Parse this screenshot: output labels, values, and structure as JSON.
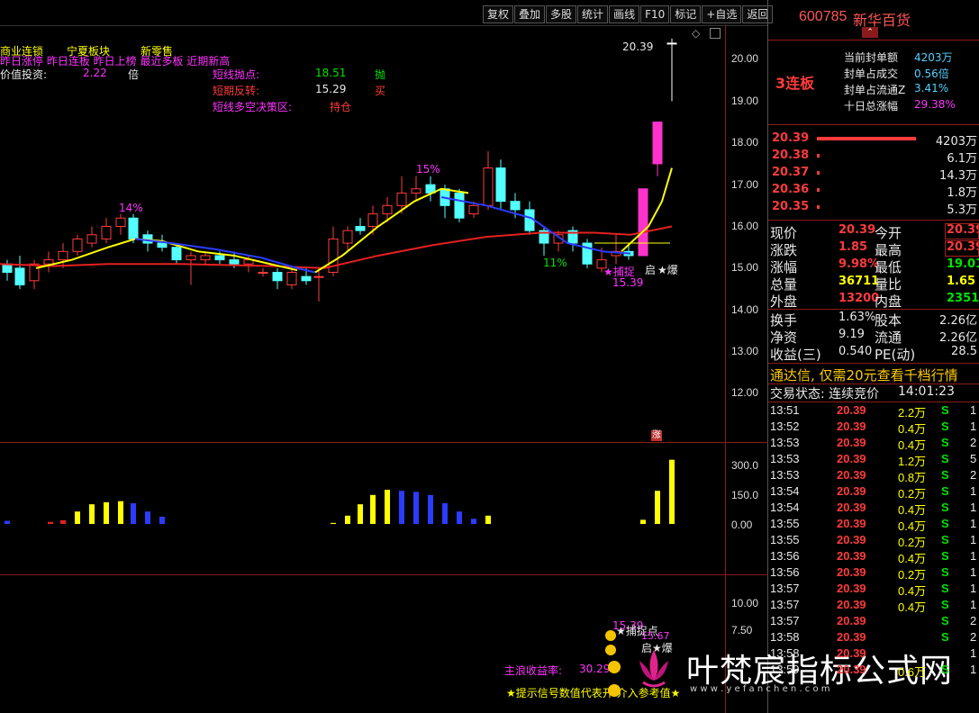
{
  "toolbar": {
    "buttons": [
      "复权",
      "叠加",
      "多股",
      "统计",
      "画线",
      "F10",
      "标记",
      "+自选",
      "返回"
    ]
  },
  "main_chart": {
    "indicator_line1": [
      "商业连锁",
      "宁夏板块",
      "新零售"
    ],
    "indicator_line2": "昨日涨停 昨日连板 昨日上榜 最近多板 近期新高",
    "value_label": "价值投资:",
    "value_num": "2.22",
    "value_unit": "倍",
    "signal_rows": [
      {
        "label": "短线抛点:",
        "value": "18.51",
        "action": "抛"
      },
      {
        "label": "短期反转:",
        "value": "15.29",
        "action": "买"
      },
      {
        "label": "短线多空决策区:",
        "value": "",
        "action": "持仓"
      }
    ],
    "peak_label": "20.39",
    "annotations": {
      "p1": "14%",
      "p2": "15%",
      "p3": "11%",
      "capture": "★捕捉",
      "capture_price": "15.39",
      "qi": "启",
      "bao": "★爆"
    },
    "y_ticks": [
      "20.00",
      "19.00",
      "18.00",
      "17.00",
      "16.00",
      "15.00",
      "14.00",
      "13.00",
      "12.00"
    ]
  },
  "volume_chart": {
    "y_ticks": [
      "300.0",
      "150.0",
      "0.00"
    ],
    "zhang_tag": "涨"
  },
  "lower_chart": {
    "y_ticks": [
      "10.00",
      "7.50"
    ],
    "price_top": "15.39",
    "capture_point": "★捕捉点",
    "partial_value": "15.67",
    "qi_bao": "启★爆",
    "income_label": "主浪收益率:",
    "income_value": "30.29",
    "footer_hint": "★提示信号数值代表开   介入参考值★"
  },
  "watermark": {
    "title": "叶梵宸指标公式网",
    "url": "w w w . y e f a n c h e n . c o m"
  },
  "stock": {
    "code": "600785",
    "name": "新华百货",
    "board_tag": "3连板",
    "seal": [
      {
        "label": "当前封单额",
        "value": "4203万"
      },
      {
        "label": "封单占成交",
        "value": "0.56倍"
      },
      {
        "label": "封单占流通Z",
        "value": "3.41%"
      },
      {
        "label": "十日总涨幅",
        "value": "29.38%"
      }
    ],
    "bids": [
      {
        "price": "20.39",
        "vol": "4203万",
        "bar": 1.0
      },
      {
        "price": "20.38",
        "vol": "6.1万",
        "bar": 0.02
      },
      {
        "price": "20.37",
        "vol": "14.3万",
        "bar": 0.03
      },
      {
        "price": "20.36",
        "vol": "1.8万",
        "bar": 0.01
      },
      {
        "price": "20.35",
        "vol": "5.3万",
        "bar": 0.02
      }
    ],
    "quote": [
      [
        "现价",
        "20.39",
        "今开",
        "20.39"
      ],
      [
        "涨跌",
        "1.85",
        "最高",
        "20.39"
      ],
      [
        "涨幅",
        "9.98%",
        "最低",
        "19.01"
      ],
      [
        "总量",
        "36711",
        "量比",
        "1.65"
      ],
      [
        "外盘",
        "13200",
        "内盘",
        "23511"
      ]
    ],
    "stats": [
      [
        "换手",
        "1.63%",
        "股本",
        "2.26亿"
      ],
      [
        "净资",
        "9.19",
        "流通",
        "2.26亿"
      ],
      [
        "收益(三)",
        "0.540",
        "PE(动)",
        "28.5"
      ]
    ],
    "promo": "通达信, 仅需20元查看千档行情",
    "trade_state_label": "交易状态: 连续竞价",
    "trade_time": "14:01:23",
    "ticks": [
      [
        "13:51",
        "20.39",
        "2.2万",
        "S",
        "1"
      ],
      [
        "13:52",
        "20.39",
        "0.4万",
        "S",
        "1"
      ],
      [
        "13:53",
        "20.39",
        "0.4万",
        "S",
        "2"
      ],
      [
        "13:53",
        "20.39",
        "1.2万",
        "S",
        "5"
      ],
      [
        "13:53",
        "20.39",
        "0.8万",
        "S",
        "2"
      ],
      [
        "13:54",
        "20.39",
        "0.2万",
        "S",
        "1"
      ],
      [
        "13:54",
        "20.39",
        "0.4万",
        "S",
        "1"
      ],
      [
        "13:55",
        "20.39",
        "0.4万",
        "S",
        "1"
      ],
      [
        "13:55",
        "20.39",
        "0.2万",
        "S",
        "1"
      ],
      [
        "13:56",
        "20.39",
        "0.4万",
        "S",
        "1"
      ],
      [
        "13:56",
        "20.39",
        "0.2万",
        "S",
        "1"
      ],
      [
        "13:57",
        "20.39",
        "0.4万",
        "S",
        "1"
      ],
      [
        "13:57",
        "20.39",
        "0.4万",
        "S",
        "1"
      ],
      [
        "13:57",
        "20.39",
        "",
        "S",
        "2"
      ],
      [
        "13:58",
        "20.39",
        "",
        "S",
        "2"
      ],
      [
        "13:58",
        "20.39",
        "",
        "",
        "1"
      ],
      [
        "13:59",
        "20.39",
        "0.6万",
        "S",
        "1"
      ]
    ]
  }
}
